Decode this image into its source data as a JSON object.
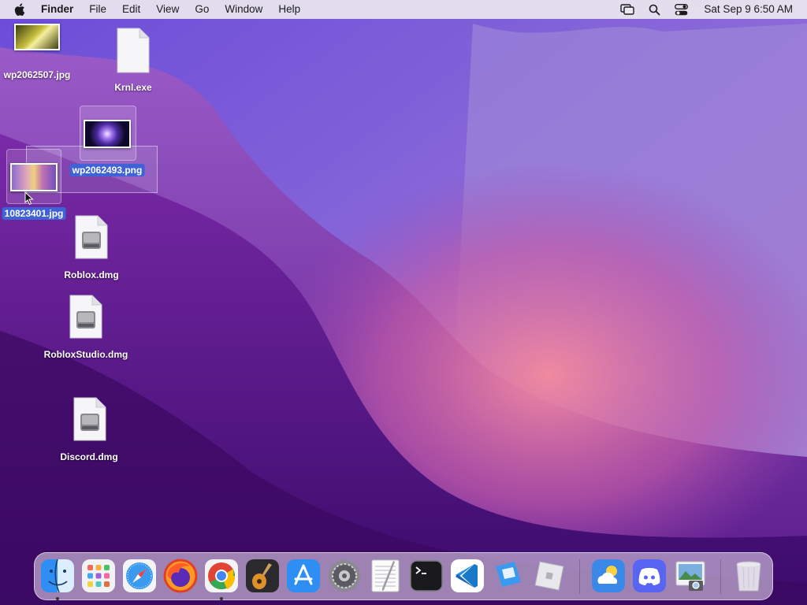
{
  "menubar": {
    "app_name": "Finder",
    "menus": [
      "File",
      "Edit",
      "View",
      "Go",
      "Window",
      "Help"
    ],
    "clock": "Sat Sep 9  6:50 AM"
  },
  "desktop": {
    "icons": [
      {
        "label": "wp2062507.jpg"
      },
      {
        "label": "Krnl.exe"
      },
      {
        "label": "wp2062493.png"
      },
      {
        "label": "10823401.jpg"
      },
      {
        "label": "Roblox.dmg"
      },
      {
        "label": "RobloxStudio.dmg"
      },
      {
        "label": "Discord.dmg"
      }
    ]
  },
  "dock": {
    "apps": [
      "finder-icon",
      "launchpad-icon",
      "safari-icon",
      "firefox-icon",
      "chrome-icon",
      "garageband-icon",
      "app-store-icon",
      "system-settings-icon",
      "textedit-icon",
      "terminal-icon",
      "vscode-icon",
      "roblox-studio-icon",
      "roblox-icon",
      "weather-icon",
      "discord-icon",
      "preview-icon",
      "trash-icon"
    ]
  },
  "colors": {
    "accent_selection": "#3f62d6",
    "wallpaper_base": "#5a2a9a"
  }
}
